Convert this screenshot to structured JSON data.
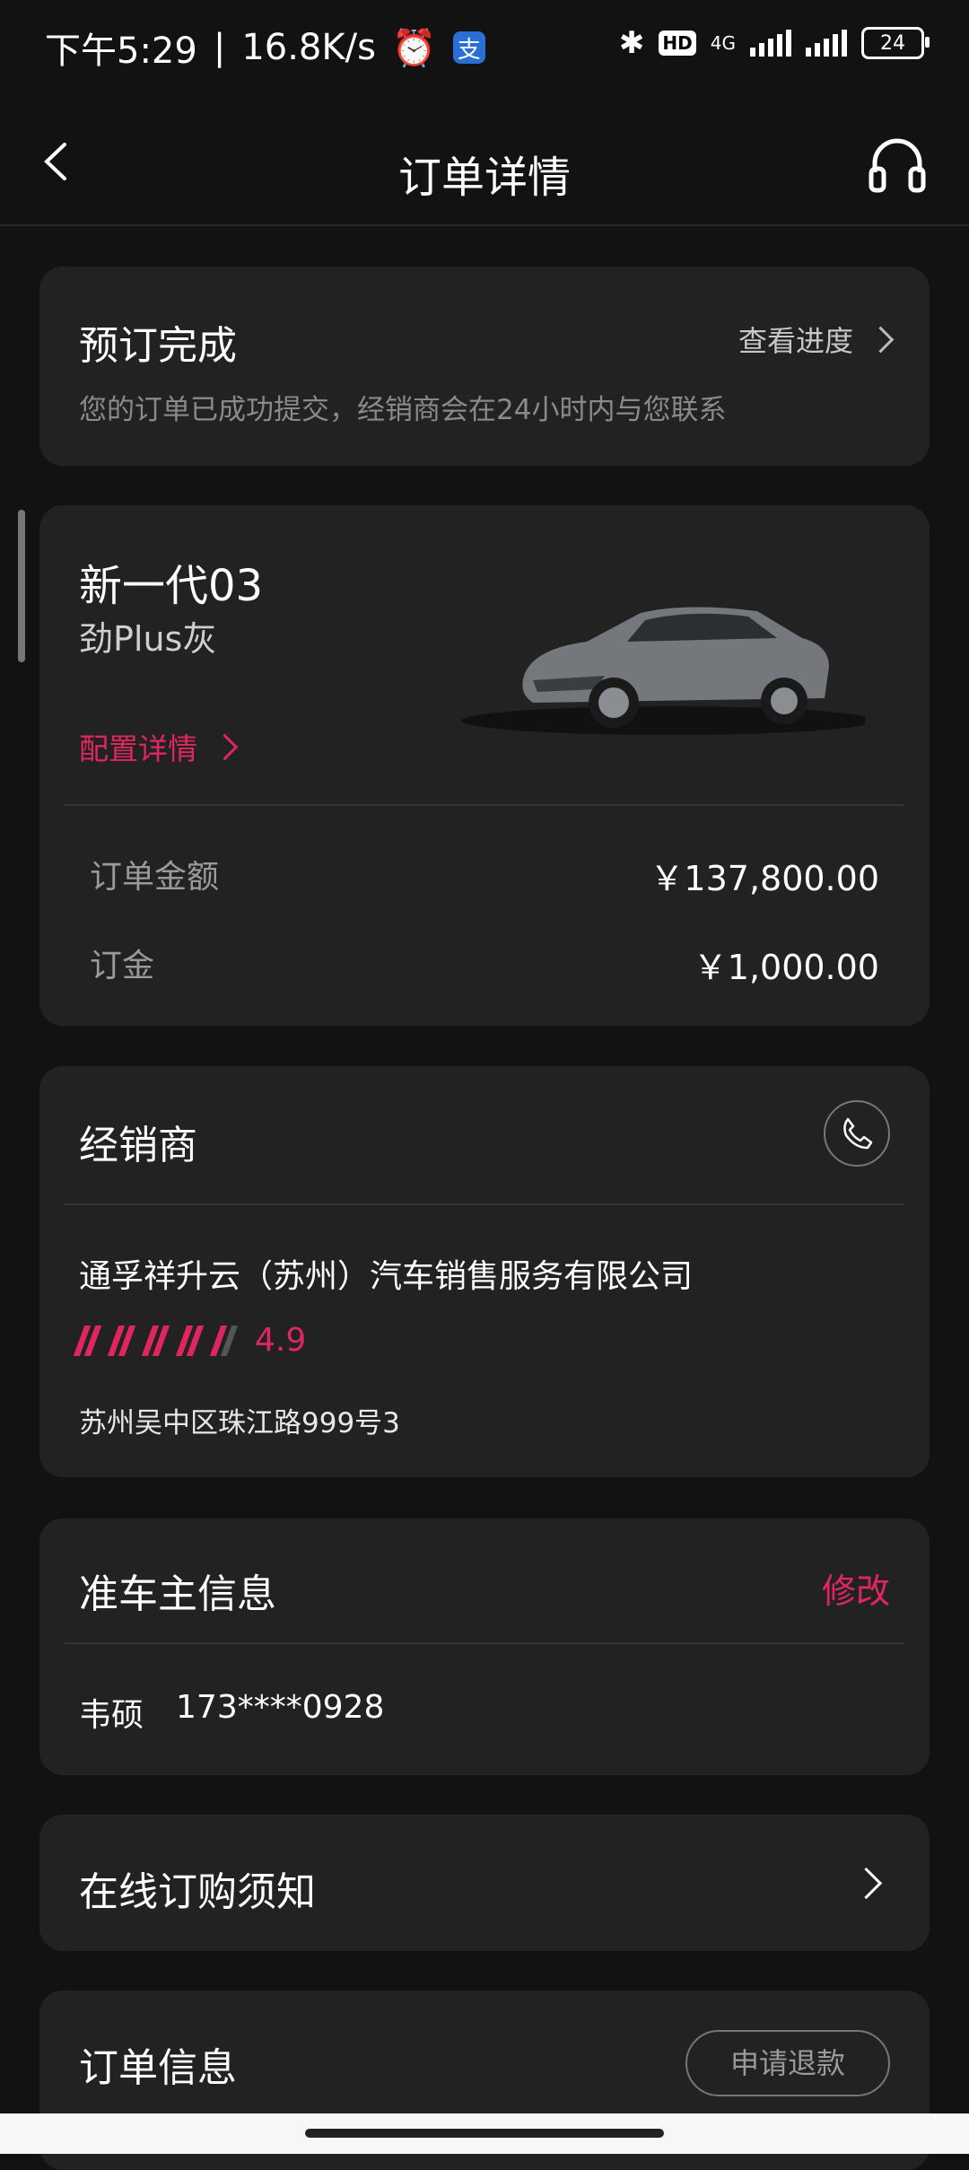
{
  "status_bar": {
    "time": "下午5:29",
    "net_speed": "16.8K/s",
    "battery": "24",
    "network": "4G",
    "hd": "HD"
  },
  "header": {
    "title": "订单详情"
  },
  "reservation": {
    "title": "预订完成",
    "progress_link": "查看进度",
    "subtitle": "您的订单已成功提交，经销商会在24小时内与您联系"
  },
  "car": {
    "model": "新一代03",
    "color": "劲Plus灰",
    "config_link": "配置详情",
    "order_amount_label": "订单金额",
    "order_amount": "￥137,800.00",
    "deposit_label": "订金",
    "deposit": "￥1,000.00"
  },
  "dealer": {
    "title": "经销商",
    "name": "通孚祥升云（苏州）汽车销售服务有限公司",
    "rating": "4.9",
    "address": "苏州吴中区珠江路999号3"
  },
  "owner": {
    "title": "准车主信息",
    "edit": "修改",
    "name": "韦硕",
    "phone": "173****0928"
  },
  "notice": {
    "title": "在线订购须知"
  },
  "order_info": {
    "title": "订单信息",
    "refund_button": "申请退款"
  }
}
